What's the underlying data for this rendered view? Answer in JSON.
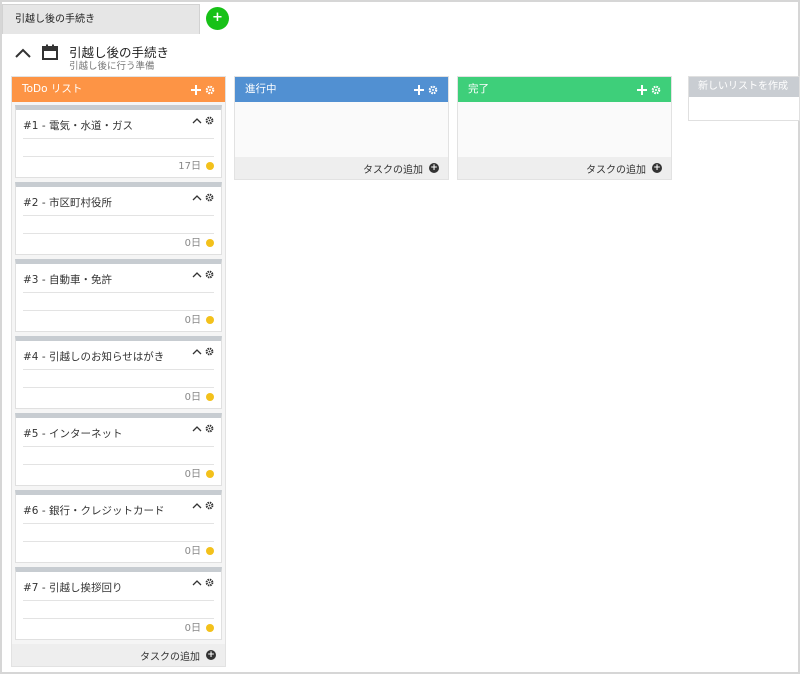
{
  "colors": {
    "todo": "#fd9445",
    "in_progress": "#5190d2",
    "done": "#3ecf7a",
    "due_dot": "#f3c11b",
    "add_tab": "#17c117"
  },
  "tab": {
    "label": "引越し後の手続き",
    "add_label": "+"
  },
  "project": {
    "title": "引越し後の手続き",
    "subtitle": "引越し後に行う準備",
    "collapse_icon": "chevron-up-icon",
    "icon": "calendar-icon"
  },
  "lists": [
    {
      "title": "ToDo リスト",
      "footer": "タスクの追加",
      "cards": [
        {
          "title": "#1 - 電気・水道・ガス",
          "days": "17日"
        },
        {
          "title": "#2 - 市区町村役所",
          "days": "0日"
        },
        {
          "title": "#3 - 自動車・免許",
          "days": "0日"
        },
        {
          "title": "#4 - 引越しのお知らせはがき",
          "days": "0日"
        },
        {
          "title": "#5 - インターネット",
          "days": "0日"
        },
        {
          "title": "#6 - 銀行・クレジットカード",
          "days": "0日"
        },
        {
          "title": "#7 - 引越し挨拶回り",
          "days": "0日"
        }
      ]
    },
    {
      "title": "進行中",
      "footer": "タスクの追加",
      "cards": []
    },
    {
      "title": "完了",
      "footer": "タスクの追加",
      "cards": []
    }
  ],
  "new_list": {
    "label": "新しいリストを作成"
  }
}
